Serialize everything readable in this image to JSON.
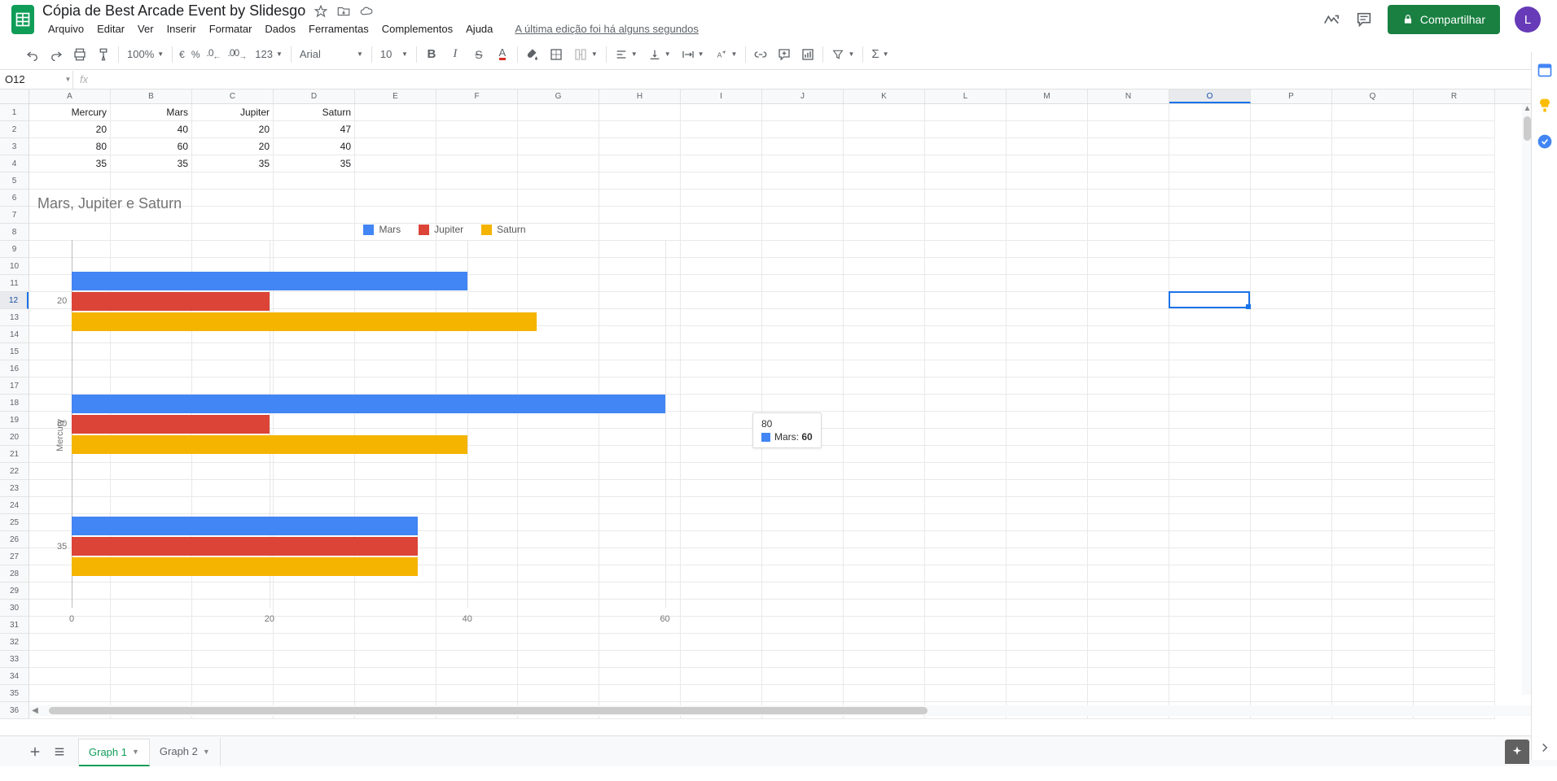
{
  "doc_title": "Cópia de Best Arcade Event by Slidesgo",
  "menu": [
    "Arquivo",
    "Editar",
    "Ver",
    "Inserir",
    "Formatar",
    "Dados",
    "Ferramentas",
    "Complementos",
    "Ajuda"
  ],
  "last_edit": "A última edição foi há alguns segundos",
  "share_label": "Compartilhar",
  "avatar_letter": "L",
  "toolbar": {
    "zoom": "100%",
    "currency": "€",
    "percent": "%",
    "dec_less": ".0",
    "dec_more": ".00",
    "num_fmt": "123",
    "font": "Arial",
    "font_size": "10"
  },
  "namebox": "O12",
  "fx_label": "fx",
  "columns": [
    "A",
    "B",
    "C",
    "D",
    "E",
    "F",
    "G",
    "H",
    "I",
    "J",
    "K",
    "L",
    "M",
    "N",
    "O",
    "P",
    "Q",
    "R"
  ],
  "sel_col_index": 14,
  "sel_row_index": 11,
  "rows": 36,
  "data": [
    [
      "Mercury",
      "Mars",
      "Jupiter",
      "Saturn"
    ],
    [
      "20",
      "40",
      "20",
      "47"
    ],
    [
      "80",
      "60",
      "20",
      "40"
    ],
    [
      "35",
      "35",
      "35",
      "35"
    ]
  ],
  "active_cell": {
    "col": 14,
    "row": 11
  },
  "chart_data": {
    "type": "bar",
    "orientation": "horizontal",
    "title": "Mars, Jupiter e Saturn",
    "ylabel": "Mercury",
    "categories": [
      "20",
      "80",
      "35"
    ],
    "series": [
      {
        "name": "Mars",
        "color": "#4285f4",
        "values": [
          40,
          60,
          35
        ]
      },
      {
        "name": "Jupiter",
        "color": "#db4437",
        "values": [
          20,
          20,
          35
        ]
      },
      {
        "name": "Saturn",
        "color": "#f4b400",
        "values": [
          47,
          40,
          35
        ]
      }
    ],
    "x_ticks": [
      0,
      20,
      40,
      60
    ],
    "xlim": [
      0,
      70
    ]
  },
  "tooltip": {
    "category": "80",
    "series": "Mars",
    "value": "60",
    "color": "#4285f4"
  },
  "sheet_tabs": [
    {
      "name": "Graph 1",
      "active": true
    },
    {
      "name": "Graph 2",
      "active": false
    }
  ]
}
